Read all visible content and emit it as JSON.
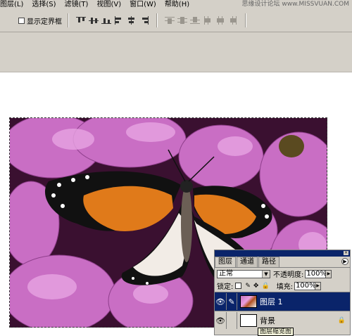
{
  "menu": [
    "图层(L)",
    "选择(S)",
    "滤镜(T)",
    "视图(V)",
    "窗口(W)",
    "帮助(H)"
  ],
  "watermark": "思缘设计论坛 www.MISSVUAN.COM",
  "options": {
    "show_bounding_box": "显示定界框"
  },
  "icons": {
    "align_group": [
      "align-top-icon",
      "align-vcenter-icon",
      "align-bottom-icon",
      "align-left-icon",
      "align-hcenter-icon",
      "align-right-icon"
    ],
    "distribute_group": [
      "distribute-top-icon",
      "distribute-vcenter-icon",
      "distribute-bottom-icon",
      "distribute-left-icon",
      "distribute-hcenter-icon",
      "distribute-right-icon"
    ]
  },
  "layers_panel": {
    "tabs": [
      "图层",
      "通道",
      "路径"
    ],
    "blend_mode": "正常",
    "opacity_label": "不透明度:",
    "opacity_value": "100%",
    "lock_label": "锁定:",
    "fill_label": "填充:",
    "fill_value": "100%",
    "layers": [
      {
        "name": "图层 1",
        "selected": true
      },
      {
        "name": "背景",
        "selected": false
      }
    ],
    "tooltip": "图层缩览图"
  },
  "colors": {
    "panel_title": "#0a246a",
    "chrome": "#d4d0c8"
  }
}
